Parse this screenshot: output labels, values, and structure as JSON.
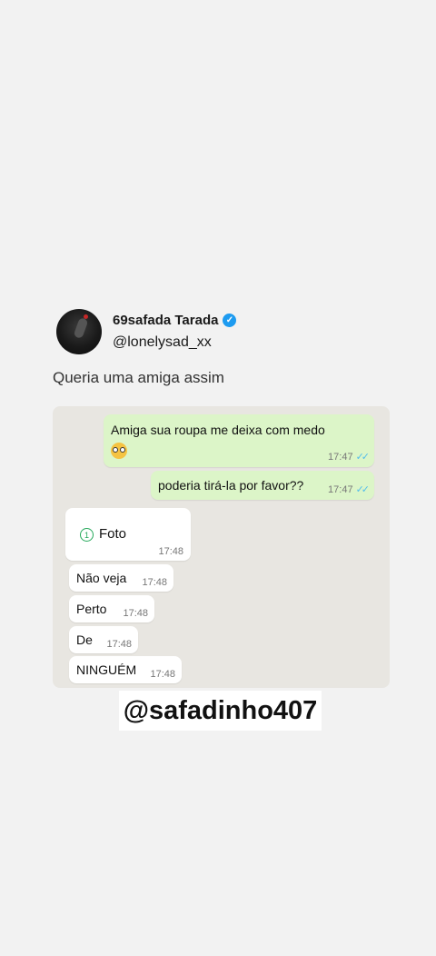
{
  "tweet": {
    "display_name": "69safada  Tarada",
    "handle": "@lonelysad_xx",
    "text": "Queria uma amiga assim",
    "verified_icon": "verified-badge-icon"
  },
  "chat": {
    "outgoing": [
      {
        "text": "Amiga sua roupa me deixa com medo",
        "time": "17:47",
        "emoji": "pleading-face-icon"
      },
      {
        "text": "poderia tirá-la por favor??",
        "time": "17:47"
      }
    ],
    "incoming": [
      {
        "label": "Foto",
        "time": "17:48",
        "icon": "view-once-icon",
        "view_once_glyph": "1"
      },
      {
        "text": "Não veja",
        "time": "17:48"
      },
      {
        "text": "Perto",
        "time": "17:48"
      },
      {
        "text": "De",
        "time": "17:48"
      },
      {
        "text": "NINGUÉM",
        "time": "17:48"
      }
    ],
    "read_ticks": "✓✓",
    "colors": {
      "outgoing_bubble": "#dcf5c8",
      "incoming_bubble": "#ffffff",
      "ticks": "#53bdeb"
    }
  },
  "overlay": {
    "tag": "@safadinho407"
  }
}
